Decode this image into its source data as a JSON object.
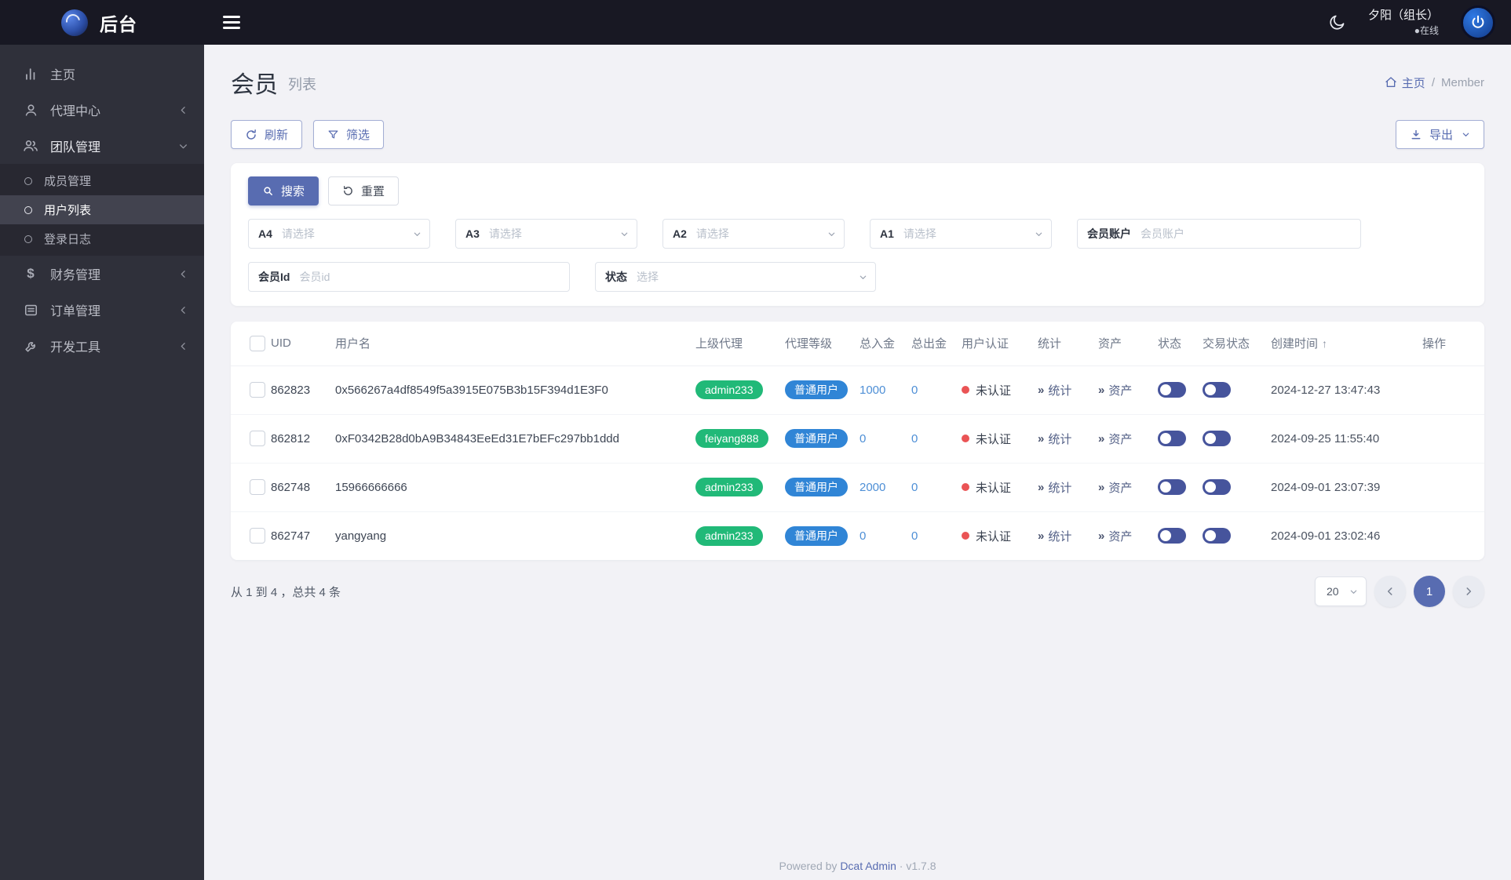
{
  "brand": {
    "title": "后台"
  },
  "topbar": {
    "user_name": "夕阳（组长）",
    "user_status": "●在线"
  },
  "sidebar": {
    "home": "主页",
    "agent_center": "代理中心",
    "team": "团队管理",
    "team_children": {
      "members": "成员管理",
      "users": "用户列表",
      "logs": "登录日志"
    },
    "finance": "财务管理",
    "orders": "订单管理",
    "devtools": "开发工具"
  },
  "page": {
    "title": "会员",
    "subtitle": "列表",
    "breadcrumb_home": "主页",
    "breadcrumb_sep": "/",
    "breadcrumb_current": "Member"
  },
  "toolbar": {
    "refresh": "刷新",
    "filter": "筛选",
    "export": "导出"
  },
  "filterbar": {
    "search": "搜索",
    "reset": "重置",
    "a4_label": "A4",
    "a4_placeholder": "请选择",
    "a3_label": "A3",
    "a3_placeholder": "请选择",
    "a2_label": "A2",
    "a2_placeholder": "请选择",
    "a1_label": "A1",
    "a1_placeholder": "请选择",
    "account_label": "会员账户",
    "account_placeholder": "会员账户",
    "memberid_label": "会员Id",
    "memberid_placeholder": "会员id",
    "status_label": "状态",
    "status_placeholder": "选择"
  },
  "table": {
    "headers": {
      "uid": "UID",
      "username": "用户名",
      "agent": "上级代理",
      "level": "代理等级",
      "deposit": "总入金",
      "withdraw": "总出金",
      "auth": "用户认证",
      "stats": "统计",
      "assets": "资产",
      "status": "状态",
      "trade_status": "交易状态",
      "created": "创建时间",
      "actions": "操作"
    },
    "rows": [
      {
        "uid": "862823",
        "username": "0x566267a4df8549f5a3915E075B3b15F394d1E3F0",
        "agent": "admin233",
        "level": "普通用户",
        "deposit": "1000",
        "withdraw": "0",
        "auth": "未认证",
        "stats": "统计",
        "assets": "资产",
        "created": "2024-12-27 13:47:43"
      },
      {
        "uid": "862812",
        "username": "0xF0342B28d0bA9B34843EeEd31E7bEFc297bb1ddd",
        "agent": "feiyang888",
        "level": "普通用户",
        "deposit": "0",
        "withdraw": "0",
        "auth": "未认证",
        "stats": "统计",
        "assets": "资产",
        "created": "2024-09-25 11:55:40"
      },
      {
        "uid": "862748",
        "username": "15966666666",
        "agent": "admin233",
        "level": "普通用户",
        "deposit": "2000",
        "withdraw": "0",
        "auth": "未认证",
        "stats": "统计",
        "assets": "资产",
        "created": "2024-09-01 23:07:39"
      },
      {
        "uid": "862747",
        "username": "yangyang",
        "agent": "admin233",
        "level": "普通用户",
        "deposit": "0",
        "withdraw": "0",
        "auth": "未认证",
        "stats": "统计",
        "assets": "资产",
        "created": "2024-09-01 23:02:46"
      }
    ]
  },
  "pagination": {
    "summary": "从 1 到 4 ，总共 4 条",
    "per_page": "20",
    "page": "1"
  },
  "footer": {
    "powered": "Powered by",
    "brand": "Dcat Admin",
    "dot": "·",
    "version": "v1.7.8"
  },
  "colors": {
    "primary": "#586cb1",
    "success_badge": "#21b978",
    "info_badge": "#3085d6",
    "danger_dot": "#ea5455",
    "topbar_bg": "#181823",
    "sidebar_bg": "#2f303a"
  }
}
